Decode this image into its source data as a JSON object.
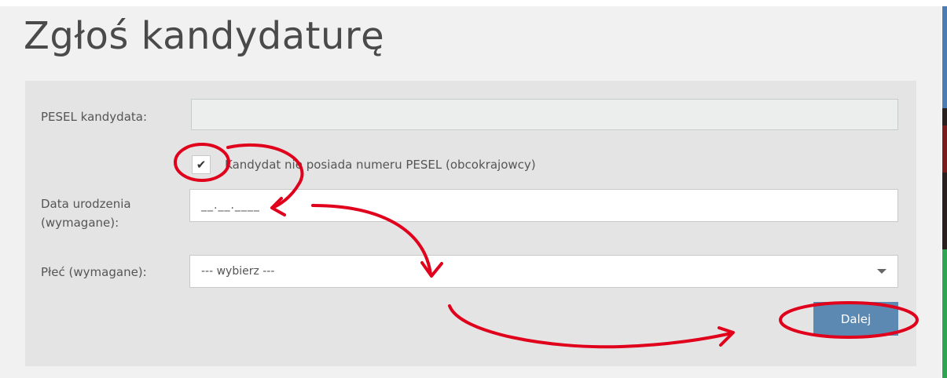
{
  "page": {
    "title": "Zgłoś kandydaturę"
  },
  "form": {
    "pesel_label": "PESEL kandydata:",
    "pesel_value": "",
    "no_pesel_label": "Kandydat nie posiada numeru PESEL (obcokrajowcy)",
    "no_pesel_checked": true,
    "birthdate_label_line1": "Data urodzenia",
    "birthdate_label_line2": "(wymagane):",
    "birthdate_value": "__.__.____",
    "gender_label": "Płeć (wymagane):",
    "gender_value": "--- wybierz ---",
    "next_button": "Dalej"
  },
  "icons": {
    "checkbox_mark": "checkmark-icon",
    "select_arrow": "caret-down-icon"
  },
  "colors": {
    "accent": "#5b89b1",
    "annotation": "#e0001b"
  }
}
